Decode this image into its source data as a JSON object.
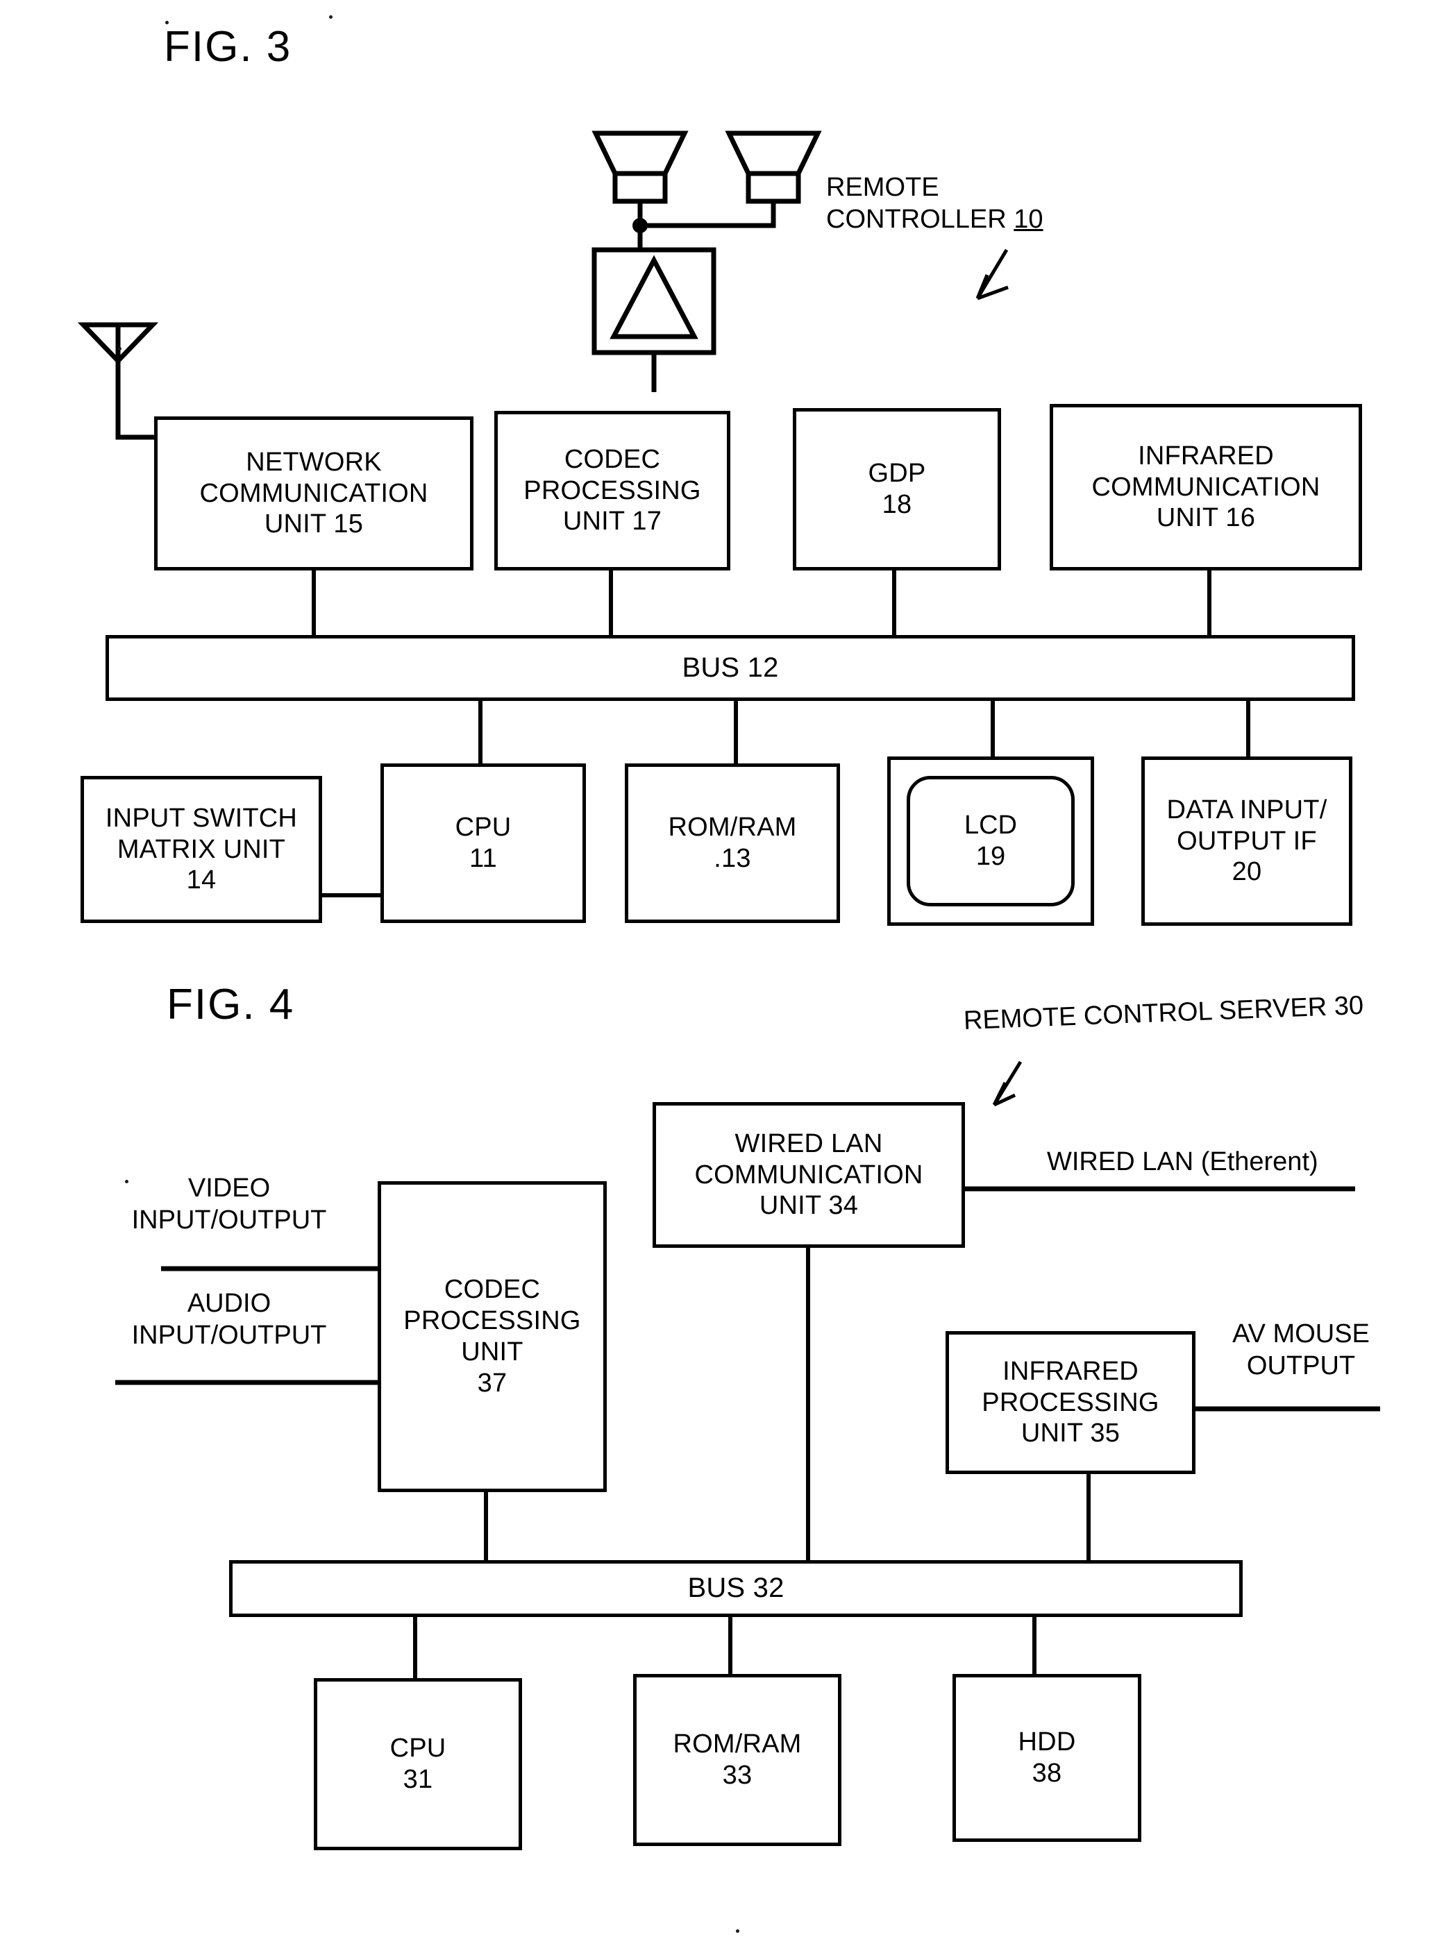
{
  "document": {
    "figures": [
      {
        "id": "fig3",
        "title": "FIG. 3",
        "callout": "REMOTE\nCONTROLLER ",
        "callout_ref": "10",
        "bus": "BUS 12",
        "symbols": {
          "antenna": "antenna-symbol",
          "speaker_left": "speaker-symbol",
          "speaker_right": "speaker-symbol",
          "amplifier": "amplifier-triangle-symbol"
        },
        "top_row": [
          {
            "name": "network-communication-unit",
            "label": "NETWORK\nCOMMUNICATION\nUNIT 15"
          },
          {
            "name": "codec-processing-unit",
            "label": "CODEC\nPROCESSING\nUNIT 17"
          },
          {
            "name": "gdp-unit",
            "label": "GDP\n18"
          },
          {
            "name": "infrared-communication-unit",
            "label": "INFRARED\nCOMMUNICATION\nUNIT 16"
          }
        ],
        "bottom_row": [
          {
            "name": "input-switch-matrix-unit",
            "label": "INPUT SWITCH\nMATRIX UNIT\n14"
          },
          {
            "name": "cpu-unit",
            "label": "CPU\n11"
          },
          {
            "name": "rom-ram-unit",
            "label": "ROM/RAM\n.13"
          },
          {
            "name": "lcd-unit",
            "label": "LCD\n19"
          },
          {
            "name": "data-input-output-if-unit",
            "label": "DATA INPUT/\nOUTPUT IF\n20"
          }
        ]
      },
      {
        "id": "fig4",
        "title": "FIG. 4",
        "callout": "REMOTE CONTROL SERVER 30",
        "bus": "BUS 32",
        "io_labels": [
          {
            "name": "video-input-output-label",
            "label": "VIDEO\nINPUT/OUTPUT"
          },
          {
            "name": "audio-input-output-label",
            "label": "AUDIO\nINPUT/OUTPUT"
          },
          {
            "name": "wired-lan-ethernet-label",
            "label": "WIRED LAN (Etherent)"
          },
          {
            "name": "av-mouse-output-label",
            "label": "AV MOUSE\nOUTPUT"
          }
        ],
        "blocks": [
          {
            "name": "codec-processing-unit-37",
            "label": "CODEC\nPROCESSING\nUNIT\n37"
          },
          {
            "name": "wired-lan-communication-unit-34",
            "label": "WIRED LAN\nCOMMUNICATION\nUNIT 34"
          },
          {
            "name": "infrared-processing-unit-35",
            "label": "INFRARED\nPROCESSING\nUNIT 35"
          }
        ],
        "bottom_row": [
          {
            "name": "cpu-unit-31",
            "label": "CPU\n31"
          },
          {
            "name": "rom-ram-unit-33",
            "label": "ROM/RAM\n33"
          },
          {
            "name": "hdd-unit-38",
            "label": "HDD\n38"
          }
        ]
      }
    ]
  }
}
